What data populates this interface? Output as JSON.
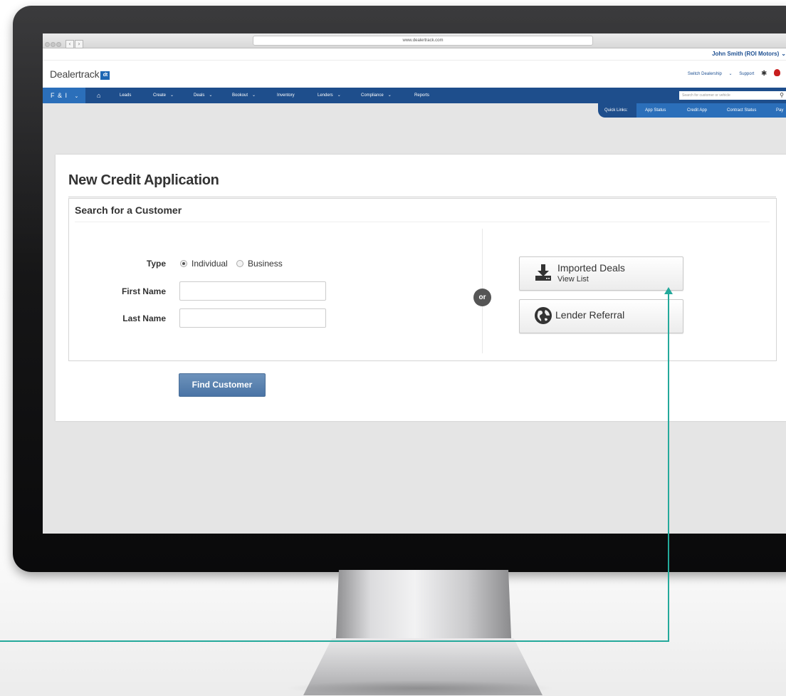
{
  "browser": {
    "url": "www.dealertrack.com"
  },
  "header": {
    "user_name": "John Smith (ROI Motors)",
    "logo_text": "Dealertrack",
    "logo_mark": "dt",
    "switch_dealership": "Switch Dealership",
    "support": "Support"
  },
  "nav": {
    "fni": "F & I",
    "items": [
      "Leads",
      "Create",
      "Deals",
      "Bookout",
      "Inventory",
      "Lenders",
      "Compliance",
      "Reports"
    ],
    "search_placeholder": "Search for customer or vehicle"
  },
  "quick_links": {
    "label": "Quick Links:",
    "links": [
      "App Status",
      "Credit App",
      "Contract Status",
      "Pay"
    ]
  },
  "page": {
    "title": "New Credit Application",
    "panel_title": "Search for a Customer",
    "type_label": "Type",
    "type_options": [
      "Individual",
      "Business"
    ],
    "type_selected": "Individual",
    "first_name_label": "First Name",
    "last_name_label": "Last Name",
    "first_name_value": "",
    "last_name_value": "",
    "or_text": "or",
    "imported_deals_label": "Imported Deals",
    "imported_deals_sub": "View List",
    "lender_referral_label": "Lender Referral",
    "find_button": "Find Customer"
  },
  "colors": {
    "nav_bg": "#1e4e8c",
    "nav_accent": "#2b6fba",
    "callout": "#24a99b",
    "find_button": "#5a82b0"
  }
}
